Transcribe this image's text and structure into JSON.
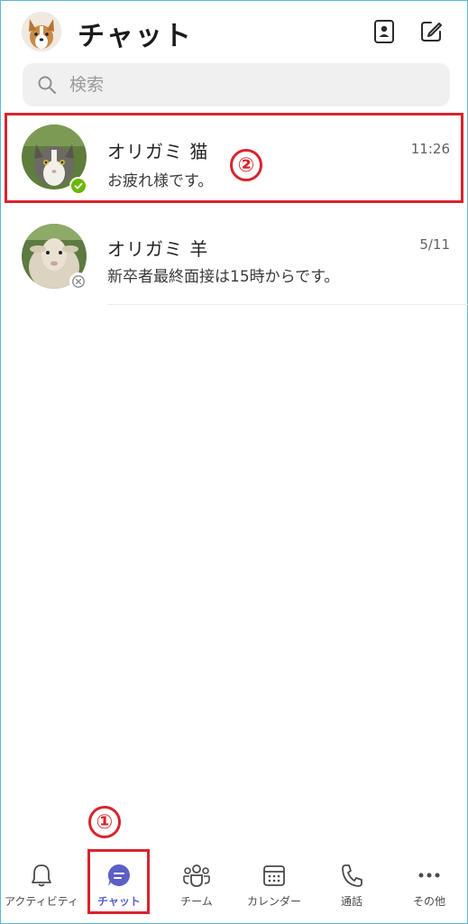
{
  "header": {
    "title": "チャット",
    "avatar_icon": "dog-avatar",
    "contacts_icon": "contacts-book-icon",
    "compose_icon": "compose-new-chat-icon"
  },
  "search": {
    "placeholder": "検索",
    "icon": "search-icon"
  },
  "chats": [
    {
      "name": "オリガミ 猫",
      "preview": "お疲れ様です。",
      "time": "11:26",
      "presence": "available",
      "avatar": "cat-photo"
    },
    {
      "name": "オリガミ 羊",
      "preview": "新卒者最終面接は15時からです。",
      "time": "5/11",
      "presence": "offline",
      "avatar": "sheep-photo"
    }
  ],
  "annotations": {
    "marker_1": "①",
    "marker_2": "②",
    "highlight_color": "#d9242c"
  },
  "bottom_nav": {
    "items": [
      {
        "label": "アクティビティ",
        "icon": "bell-icon"
      },
      {
        "label": "チャット",
        "icon": "chat-bubble-icon",
        "active": true
      },
      {
        "label": "チーム",
        "icon": "teams-icon"
      },
      {
        "label": "カレンダー",
        "icon": "calendar-icon"
      },
      {
        "label": "通話",
        "icon": "phone-icon"
      },
      {
        "label": "その他",
        "icon": "more-icon"
      }
    ]
  },
  "colors": {
    "accent": "#5b5fc7",
    "available": "#6bb700",
    "offline": "#8a8a8a",
    "frame": "#59b8d8"
  }
}
